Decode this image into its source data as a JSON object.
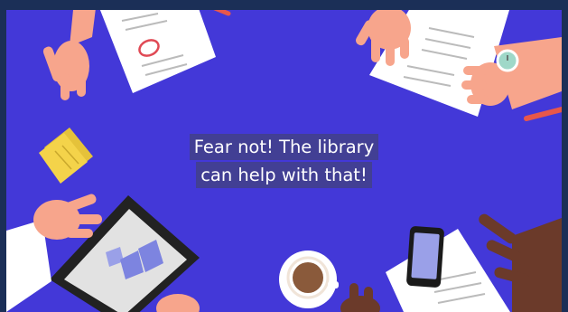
{
  "video": {
    "caption": {
      "line1": "Fear not! The library",
      "line2": "can help with that!"
    }
  },
  "colors": {
    "frame": "#1b2f57",
    "background": "#4338d8",
    "caption_bg": "#42408e",
    "caption_text": "#ffffff",
    "skin_light": "#f7a58c",
    "skin_dark": "#6b3a2a",
    "paper": "#ffffff",
    "sticky_note": "#f4d34a",
    "pen": "#e8574a",
    "tablet": "#222222",
    "coffee": "#8a5a3b"
  }
}
